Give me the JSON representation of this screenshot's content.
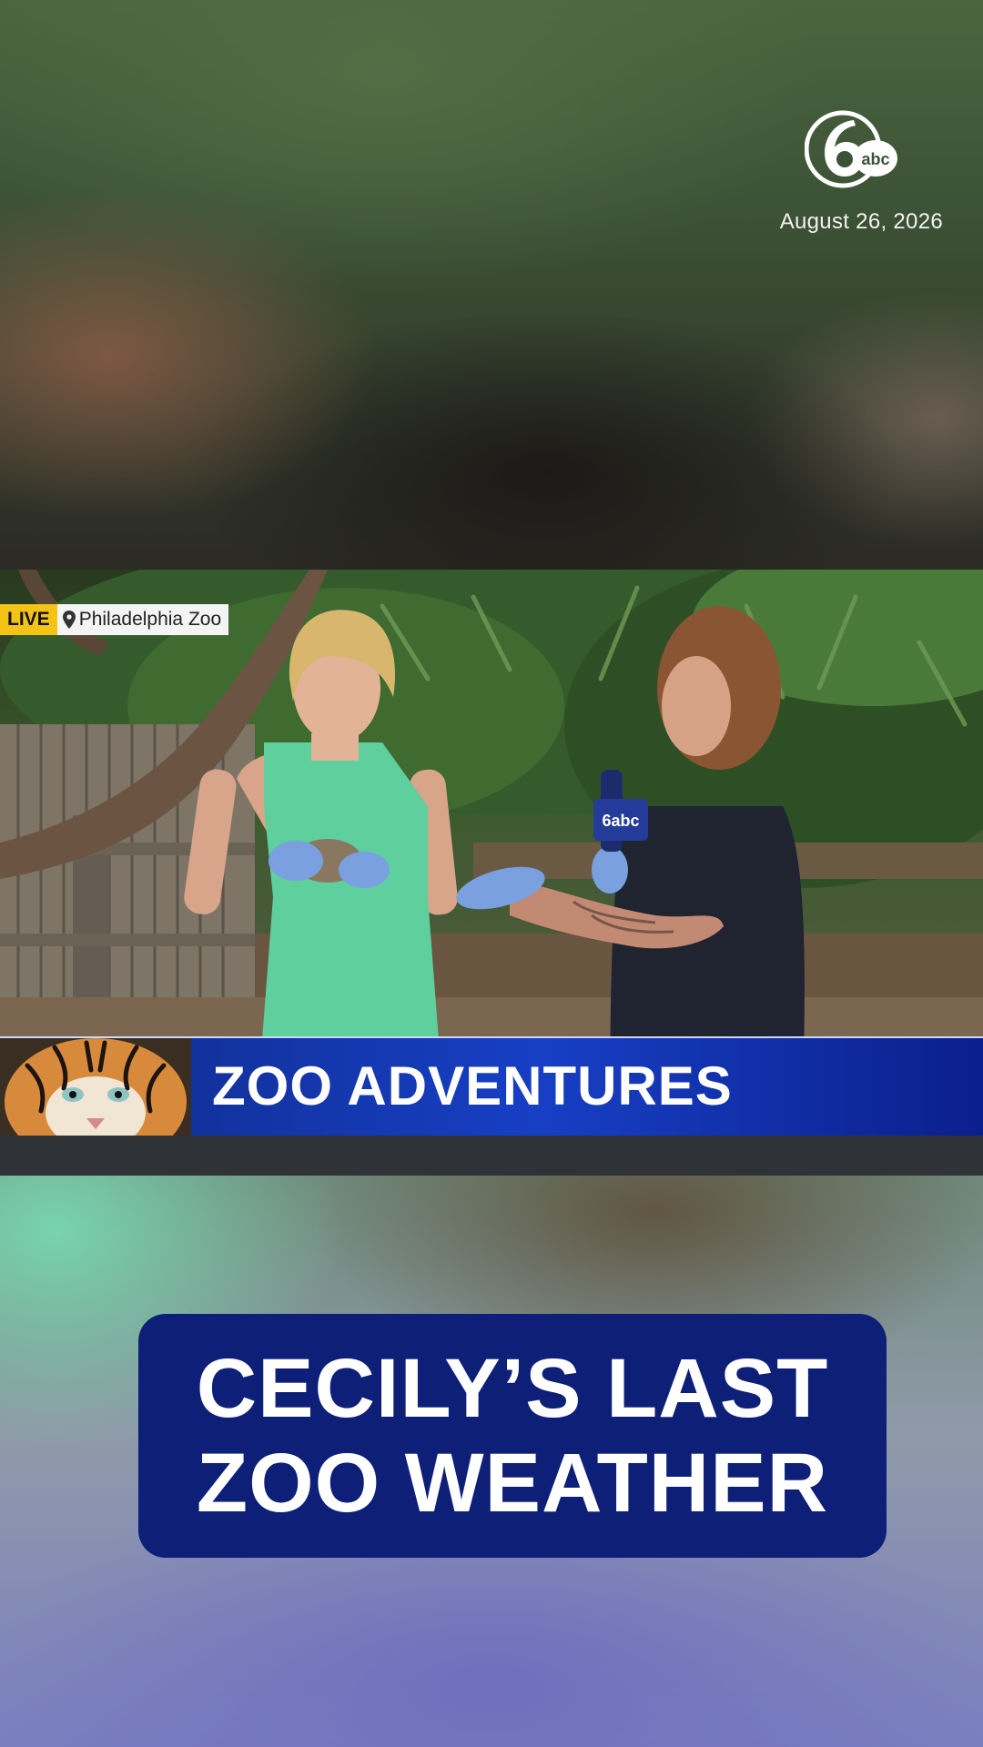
{
  "header": {
    "brand": "6abc",
    "date": "August 26, 2026"
  },
  "video": {
    "live_label": "LIVE",
    "location": "Philadelphia Zoo",
    "mic_flag_text": "6abc"
  },
  "lower_third": {
    "title": "ZOO ADVENTURES"
  },
  "headline": {
    "lines": [
      "CECILY’S LAST",
      "ZOO WEATHER"
    ]
  },
  "colors": {
    "live_yellow": "#f3c316",
    "lower_third_blue": "#173fc4",
    "headline_navy": "#0e1f78"
  }
}
